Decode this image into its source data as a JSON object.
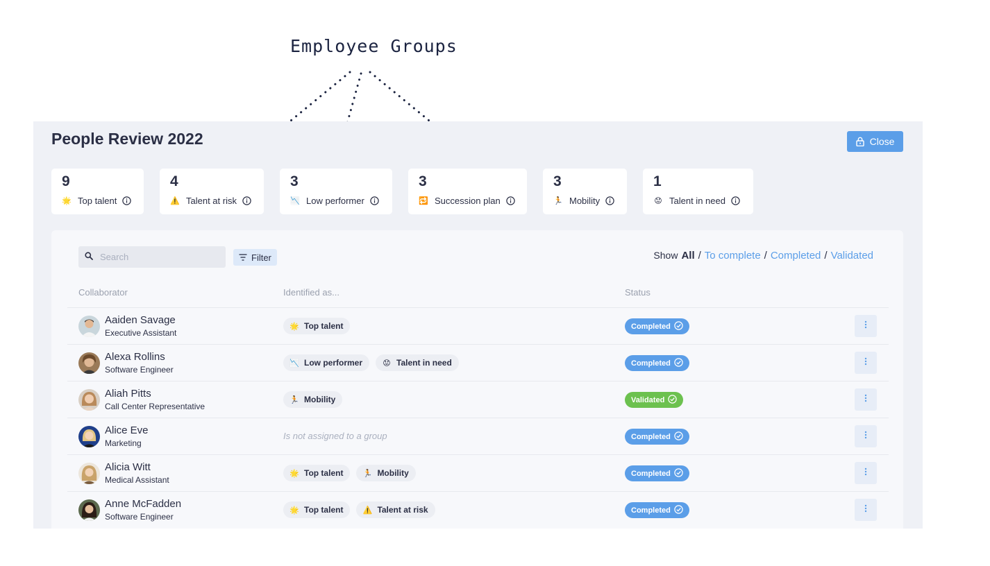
{
  "annotation": {
    "title": "Employee Groups"
  },
  "header": {
    "title": "People Review 2022",
    "close_label": "Close"
  },
  "summary_cards": [
    {
      "count": "9",
      "label": "Top talent",
      "icon": "star-icon"
    },
    {
      "count": "4",
      "label": "Talent at risk",
      "icon": "warning-icon"
    },
    {
      "count": "3",
      "label": "Low performer",
      "icon": "chart-down-icon"
    },
    {
      "count": "3",
      "label": "Succession plan",
      "icon": "repeat-icon"
    },
    {
      "count": "3",
      "label": "Mobility",
      "icon": "runner-icon"
    },
    {
      "count": "1",
      "label": "Talent in need",
      "icon": "worried-face-icon"
    }
  ],
  "toolbar": {
    "search_placeholder": "Search",
    "filter_label": "Filter",
    "show_label": "Show",
    "show_all": "All",
    "show_to_complete": "To complete",
    "show_completed": "Completed",
    "show_validated": "Validated",
    "separator": "/"
  },
  "table": {
    "headers": {
      "collaborator": "Collaborator",
      "identified_as": "Identified as...",
      "status": "Status"
    },
    "unassigned_text": "Is not assigned to a group",
    "rows": [
      {
        "name": "Aaiden Savage",
        "role": "Executive Assistant",
        "tags": [
          {
            "label": "Top talent",
            "icon": "star-icon"
          }
        ],
        "status": "Completed"
      },
      {
        "name": "Alexa Rollins",
        "role": "Software Engineer",
        "tags": [
          {
            "label": "Low performer",
            "icon": "chart-down-icon"
          },
          {
            "label": "Talent in need",
            "icon": "worried-face-icon"
          }
        ],
        "status": "Completed"
      },
      {
        "name": "Aliah Pitts",
        "role": "Call Center Representative",
        "tags": [
          {
            "label": "Mobility",
            "icon": "runner-icon"
          }
        ],
        "status": "Validated"
      },
      {
        "name": "Alice Eve",
        "role": "Marketing",
        "tags": [],
        "status": "Completed"
      },
      {
        "name": "Alicia Witt",
        "role": "Medical Assistant",
        "tags": [
          {
            "label": "Top talent",
            "icon": "star-icon"
          },
          {
            "label": "Mobility",
            "icon": "runner-icon"
          }
        ],
        "status": "Completed"
      },
      {
        "name": "Anne McFadden",
        "role": "Software Engineer",
        "tags": [
          {
            "label": "Top talent",
            "icon": "star-icon"
          },
          {
            "label": "Talent at risk",
            "icon": "warning-icon"
          }
        ],
        "status": "Completed"
      }
    ]
  },
  "colors": {
    "accent": "#5b9ee8",
    "validated": "#6cc14f",
    "background": "#eff1f6"
  }
}
